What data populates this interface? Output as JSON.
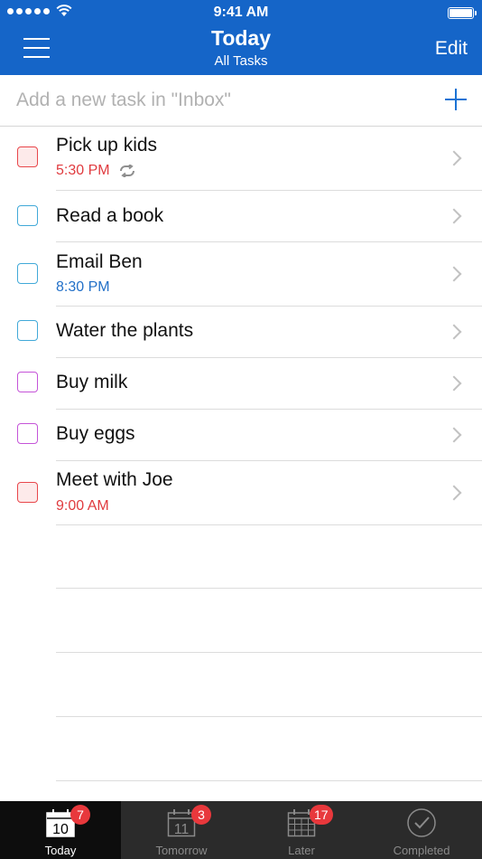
{
  "status_bar": {
    "time": "9:41 AM"
  },
  "header": {
    "title": "Today",
    "subtitle": "All Tasks",
    "edit_label": "Edit"
  },
  "add_task": {
    "placeholder": "Add a new task in \"Inbox\""
  },
  "tasks": [
    {
      "name": "Pick up kids",
      "time": "5:30 PM",
      "repeat": true,
      "color": "red"
    },
    {
      "name": "Read a book",
      "color": "blue"
    },
    {
      "name": "Email Ben",
      "time": "8:30 PM",
      "color": "blue"
    },
    {
      "name": "Water the plants",
      "color": "blue"
    },
    {
      "name": "Buy milk",
      "color": "purple"
    },
    {
      "name": "Buy eggs",
      "color": "purple"
    },
    {
      "name": "Meet with Joe",
      "time": "9:00 AM",
      "color": "red"
    }
  ],
  "tabs": [
    {
      "label": "Today",
      "icon": "calendar-day-icon",
      "date": "10",
      "badge": "7",
      "active": true
    },
    {
      "label": "Tomorrow",
      "icon": "calendar-day-icon",
      "date": "11",
      "badge": "3",
      "active": false
    },
    {
      "label": "Later",
      "icon": "calendar-grid-icon",
      "badge": "17",
      "active": false
    },
    {
      "label": "Completed",
      "icon": "check-circle-icon",
      "active": false
    }
  ],
  "colors": {
    "header": "#1565c8",
    "accent": "#1a73d4",
    "red": "#e8474b",
    "blue": "#41a9d8",
    "purple": "#c554d8",
    "badge": "#e8383c"
  }
}
